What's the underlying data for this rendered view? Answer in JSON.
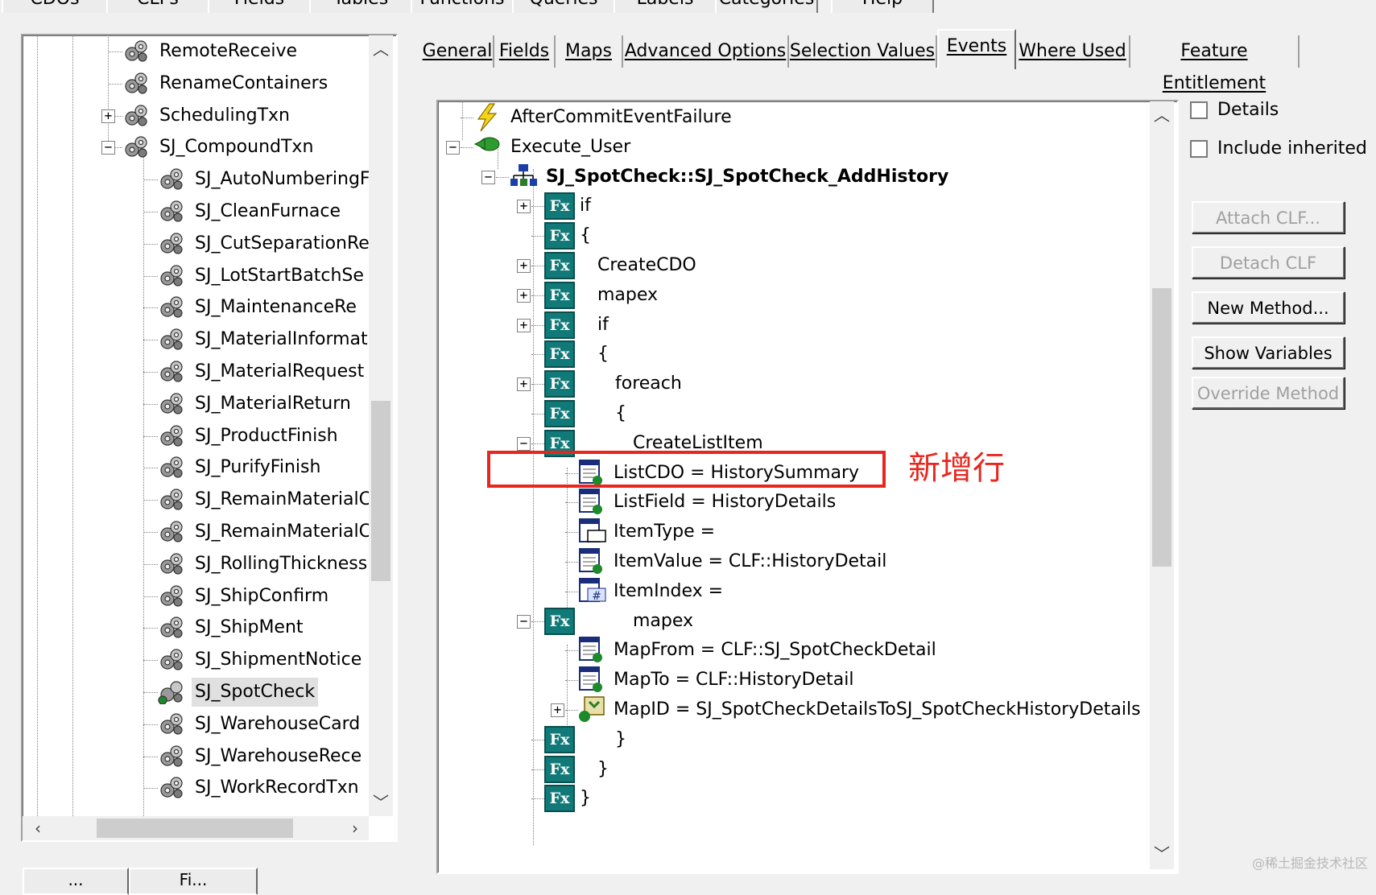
{
  "top_tabs": [
    "CDOs",
    "CLFs",
    "Fields",
    "Tables",
    "Functions",
    "Queries",
    "Labels",
    "Categories",
    "Help"
  ],
  "left_tree": {
    "items": [
      {
        "label": "RemoteReceive"
      },
      {
        "label": "RenameContainers"
      },
      {
        "label": "SchedulingTxn"
      },
      {
        "label": "SJ_CompoundTxn"
      },
      {
        "label": "SJ_AutoNumberingF"
      },
      {
        "label": "SJ_CleanFurnace"
      },
      {
        "label": "SJ_CutSeparationRe"
      },
      {
        "label": "SJ_LotStartBatchSe"
      },
      {
        "label": "SJ_MaintenanceRe"
      },
      {
        "label": "SJ_MaterialInformati"
      },
      {
        "label": "SJ_MaterialRequest"
      },
      {
        "label": "SJ_MaterialReturn"
      },
      {
        "label": "SJ_ProductFinish"
      },
      {
        "label": "SJ_PurifyFinish"
      },
      {
        "label": "SJ_RemainMaterialC"
      },
      {
        "label": "SJ_RemainMaterialC"
      },
      {
        "label": "SJ_RollingThickness"
      },
      {
        "label": "SJ_ShipConfirm"
      },
      {
        "label": "SJ_ShipMent"
      },
      {
        "label": "SJ_ShipmentNotice"
      },
      {
        "label": "SJ_SpotCheck"
      },
      {
        "label": "SJ_WarehouseCard"
      },
      {
        "label": "SJ_WarehouseRece"
      },
      {
        "label": "SJ_WorkRecordTxn"
      }
    ],
    "selected": "SJ_SpotCheck"
  },
  "tabs": [
    {
      "label": "General"
    },
    {
      "label": "Fields"
    },
    {
      "label": "Maps"
    },
    {
      "label": "Advanced Options"
    },
    {
      "label": "Selection Values"
    },
    {
      "label": "Events"
    },
    {
      "label": "Where Used"
    },
    {
      "label": "Feature Entitlement"
    }
  ],
  "active_tab": "Events",
  "events_tree": {
    "rows": [
      {
        "label": "AfterCommitEventFailure"
      },
      {
        "label": "Execute_User"
      },
      {
        "label": "SJ_SpotCheck::SJ_SpotCheck_AddHistory"
      },
      {
        "label": "if"
      },
      {
        "label": "{"
      },
      {
        "label": "CreateCDO"
      },
      {
        "label": "mapex"
      },
      {
        "label": "if"
      },
      {
        "label": "{"
      },
      {
        "label": "foreach"
      },
      {
        "label": "{"
      },
      {
        "label": "CreateListItem"
      },
      {
        "label": "ListCDO = HistorySummary"
      },
      {
        "label": "ListField = HistoryDetails"
      },
      {
        "label": "ItemType ="
      },
      {
        "label": "ItemValue = CLF::HistoryDetail"
      },
      {
        "label": "ItemIndex ="
      },
      {
        "label": "mapex"
      },
      {
        "label": "MapFrom = CLF::SJ_SpotCheckDetail"
      },
      {
        "label": "MapTo = CLF::HistoryDetail"
      },
      {
        "label": "MapID = SJ_SpotCheckDetailsToSJ_SpotCheckHistoryDetails"
      },
      {
        "label": "}"
      },
      {
        "label": "}"
      },
      {
        "label": "}"
      }
    ],
    "fx_icon_text": "Fx"
  },
  "options": {
    "details_label": "Details",
    "details_checked": false,
    "include_inherited_label": "Include inherited",
    "include_inherited_checked": false
  },
  "buttons": {
    "attach_clf": "Attach CLF...",
    "detach_clf": "Detach CLF",
    "new_method": "New Method...",
    "show_variables": "Show Variables",
    "override_method": "Override Method"
  },
  "annotation": {
    "text": "新增行",
    "color": "#e8261f"
  },
  "watermark": "@稀土掘金技术社区",
  "bottom_buttons": [
    "...",
    "Fi..."
  ]
}
